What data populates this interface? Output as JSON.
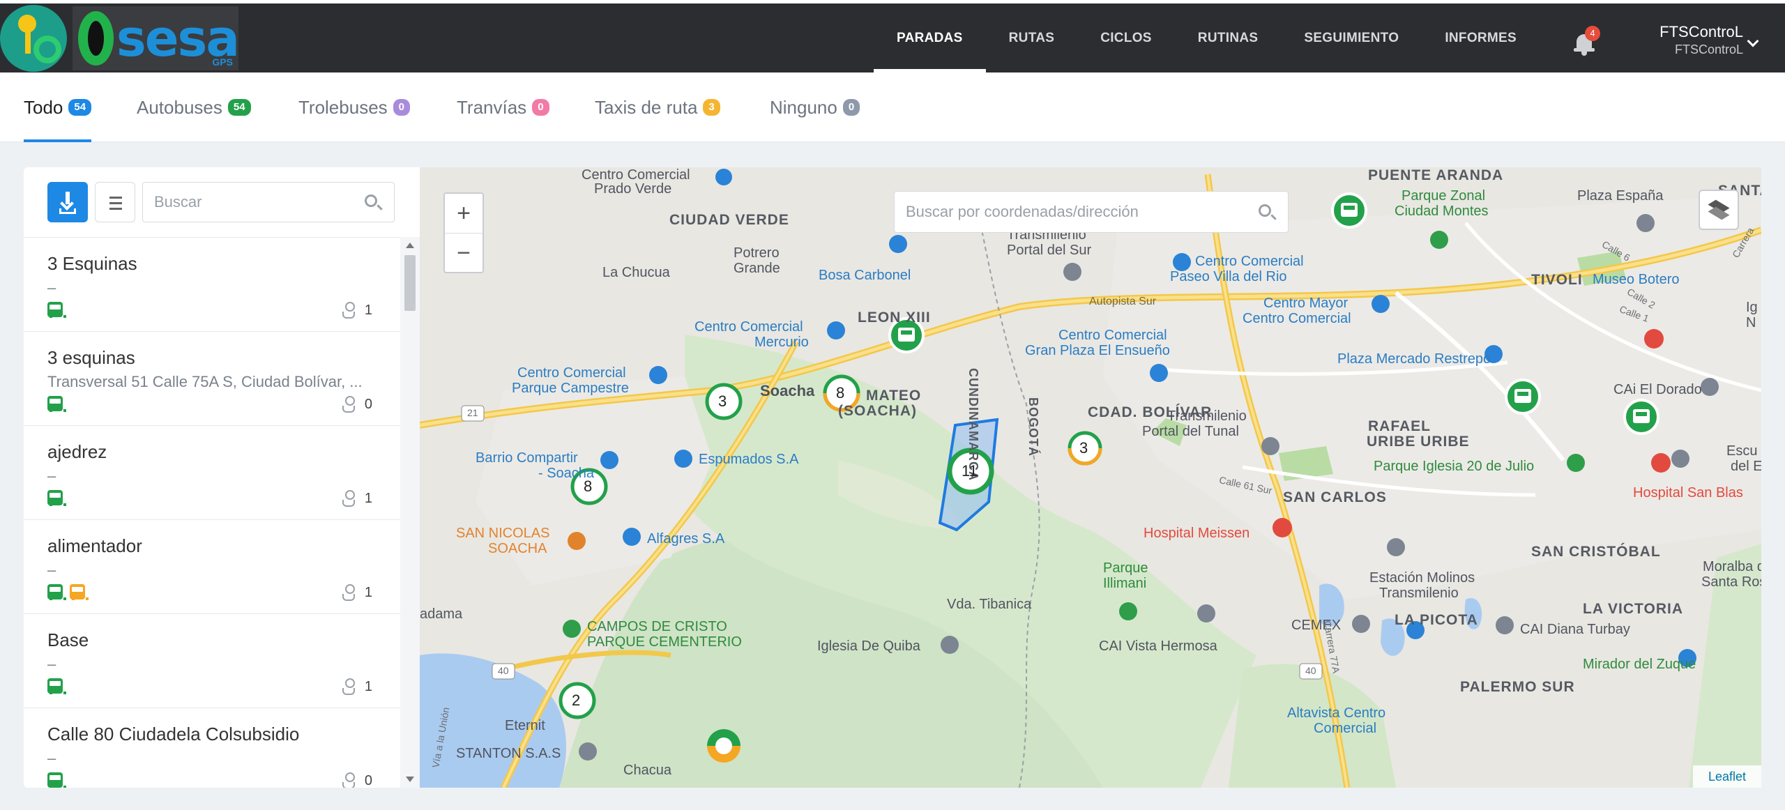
{
  "navbar": {
    "logo_text": "sesa",
    "logo_sub": "GPS",
    "menu": [
      "PARADAS",
      "RUTAS",
      "CICLOS",
      "RUTINAS",
      "SEGUIMIENTO",
      "INFORMES"
    ],
    "notifications_count": "4",
    "user_name": "FTSControL",
    "user_sub": "FTSControL"
  },
  "tabs": [
    {
      "label": "Todo",
      "count": "54",
      "color": "#1e88e5"
    },
    {
      "label": "Autobuses",
      "count": "54",
      "color": "#22a14a"
    },
    {
      "label": "Trolebuses",
      "count": "0",
      "color": "#a98bdc"
    },
    {
      "label": "Tranvías",
      "count": "0",
      "color": "#f27aa6"
    },
    {
      "label": "Taxis de ruta",
      "count": "3",
      "color": "#f5b531"
    },
    {
      "label": "Ninguno",
      "count": "0",
      "color": "#8e99ab"
    }
  ],
  "panel": {
    "search_placeholder": "Buscar",
    "items": [
      {
        "name": "3 Esquinas",
        "addr": "–",
        "stops": "1"
      },
      {
        "name": "3 esquinas",
        "addr": "Transversal 51 Calle 75A S, Ciudad Bolívar, ...",
        "stops": "0"
      },
      {
        "name": "ajedrez",
        "addr": "–",
        "stops": "1"
      },
      {
        "name": "alimentador",
        "addr": "–",
        "stops": "1"
      },
      {
        "name": "Base",
        "addr": "–",
        "stops": "1"
      },
      {
        "name": "Calle 80 Ciudadela Colsubsidio",
        "addr": "–",
        "stops": "0"
      }
    ]
  },
  "map": {
    "search_placeholder": "Buscar por coordenadas/dirección",
    "zoom_in": "+",
    "zoom_out": "−",
    "attribution": "Leaflet",
    "clusters": [
      "3",
      "8",
      "8",
      "11",
      "3",
      "2"
    ],
    "labels": {
      "centro_prado": "Centro Comercial",
      "centro_prado2": "Prado Verde",
      "ciudad_verde": "CIUDAD VERDE",
      "potrero": "Potrero",
      "grande": "Grande",
      "chucua": "La Chucua",
      "bosa": "Bosa Carbonel",
      "leon": "LEON XIII",
      "mercurio": "Centro Comercial",
      "mercurio2": "Mercurio",
      "campestre": "Centro Comercial",
      "campestre2": "Parque Campestre",
      "soacha": "Soacha",
      "mateo": "MATEO",
      "mateo2": "(SOACHA)",
      "barrio": "Barrio Compartir",
      "barrio2": "- Soacha",
      "espumados": "Espumados S.A",
      "nicolas": "SAN NICOLAS",
      "nicolas2": "SOACHA",
      "alfagres": "Alfagres S.A",
      "campos": "CAMPOS DE CRISTO",
      "campos2": "PARQUE CEMENTERIO",
      "adama": "adama",
      "eternit": "Eternit",
      "stanton": "STANTON S.A.S",
      "chacua": "Chacua",
      "quiba": "Iglesia De Quiba",
      "tibanica": "Vda. Tibanica",
      "cund": "CUNDINAMARCA",
      "bogota": "BOGOTÁ",
      "tm_sur": "Transmilenio",
      "tm_sur2": "Portal del Sur",
      "villa": "Centro Comercial",
      "villa2": "Paseo Villa del Rio",
      "autopista": "Autopista Sur",
      "ensueno": "Centro Comercial",
      "ensueno2": "Gran Plaza El Ensueño",
      "cdad_bolivar": "CDAD. BOLÍVAR",
      "tunal": "Transmilenio",
      "tunal2": "Portal del Tunal",
      "meissen": "Hospital Meissen",
      "illimani": "Parque",
      "illimani2": "Illimani",
      "cai_vista": "CAI Vista Hermosa",
      "puente": "PUENTE ARANDA",
      "zonal": "Parque Zonal",
      "zonal2": "Ciudad Montes",
      "plaza_espana": "Plaza España",
      "santa": "SANTA",
      "tivoli": "TIVOLI",
      "botero": "Museo Botero",
      "mayor": "Centro Mayor",
      "mayor2": "Centro Comercial",
      "restrepo": "Plaza Mercado Restrepo",
      "rafael": "RAFAEL",
      "uribe": "URIBE URIBE",
      "cai_dorado": "CAi El Dorado",
      "julio": "Parque Iglesia 20 de Julio",
      "san_blas": "Hospital San Blas",
      "escu": "Escu",
      "escu2": "del E",
      "san_carlos": "SAN CARLOS",
      "calle61": "Calle 61 Sur",
      "molinos": "Estación Molinos",
      "molinos2": "Transmilenio",
      "san_cristobal": "SAN CRISTÓBAL",
      "moralba": "Moralba de",
      "moralba2": "Santa Rosa",
      "victoria": "LA VICTORIA",
      "picota": "LA PICOTA",
      "cemex": "CEMEX",
      "cai_diana": "CAI Diana Turbay",
      "zuque": "Mirador del Zuque",
      "palermo": "PALERMO SUR",
      "altavista": "Altavista Centro",
      "altavista2": "Comercial",
      "r21": "21",
      "r40a": "40",
      "r40b": "40",
      "carrera77": "Carrera 77A",
      "calle6": "Calle 6",
      "calle2": "Calle 2",
      "calle1": "Calle 1",
      "via_union": "Vía a la Unión",
      "carrera": "Carrera",
      "ig": "Ig",
      "n": "N"
    }
  }
}
